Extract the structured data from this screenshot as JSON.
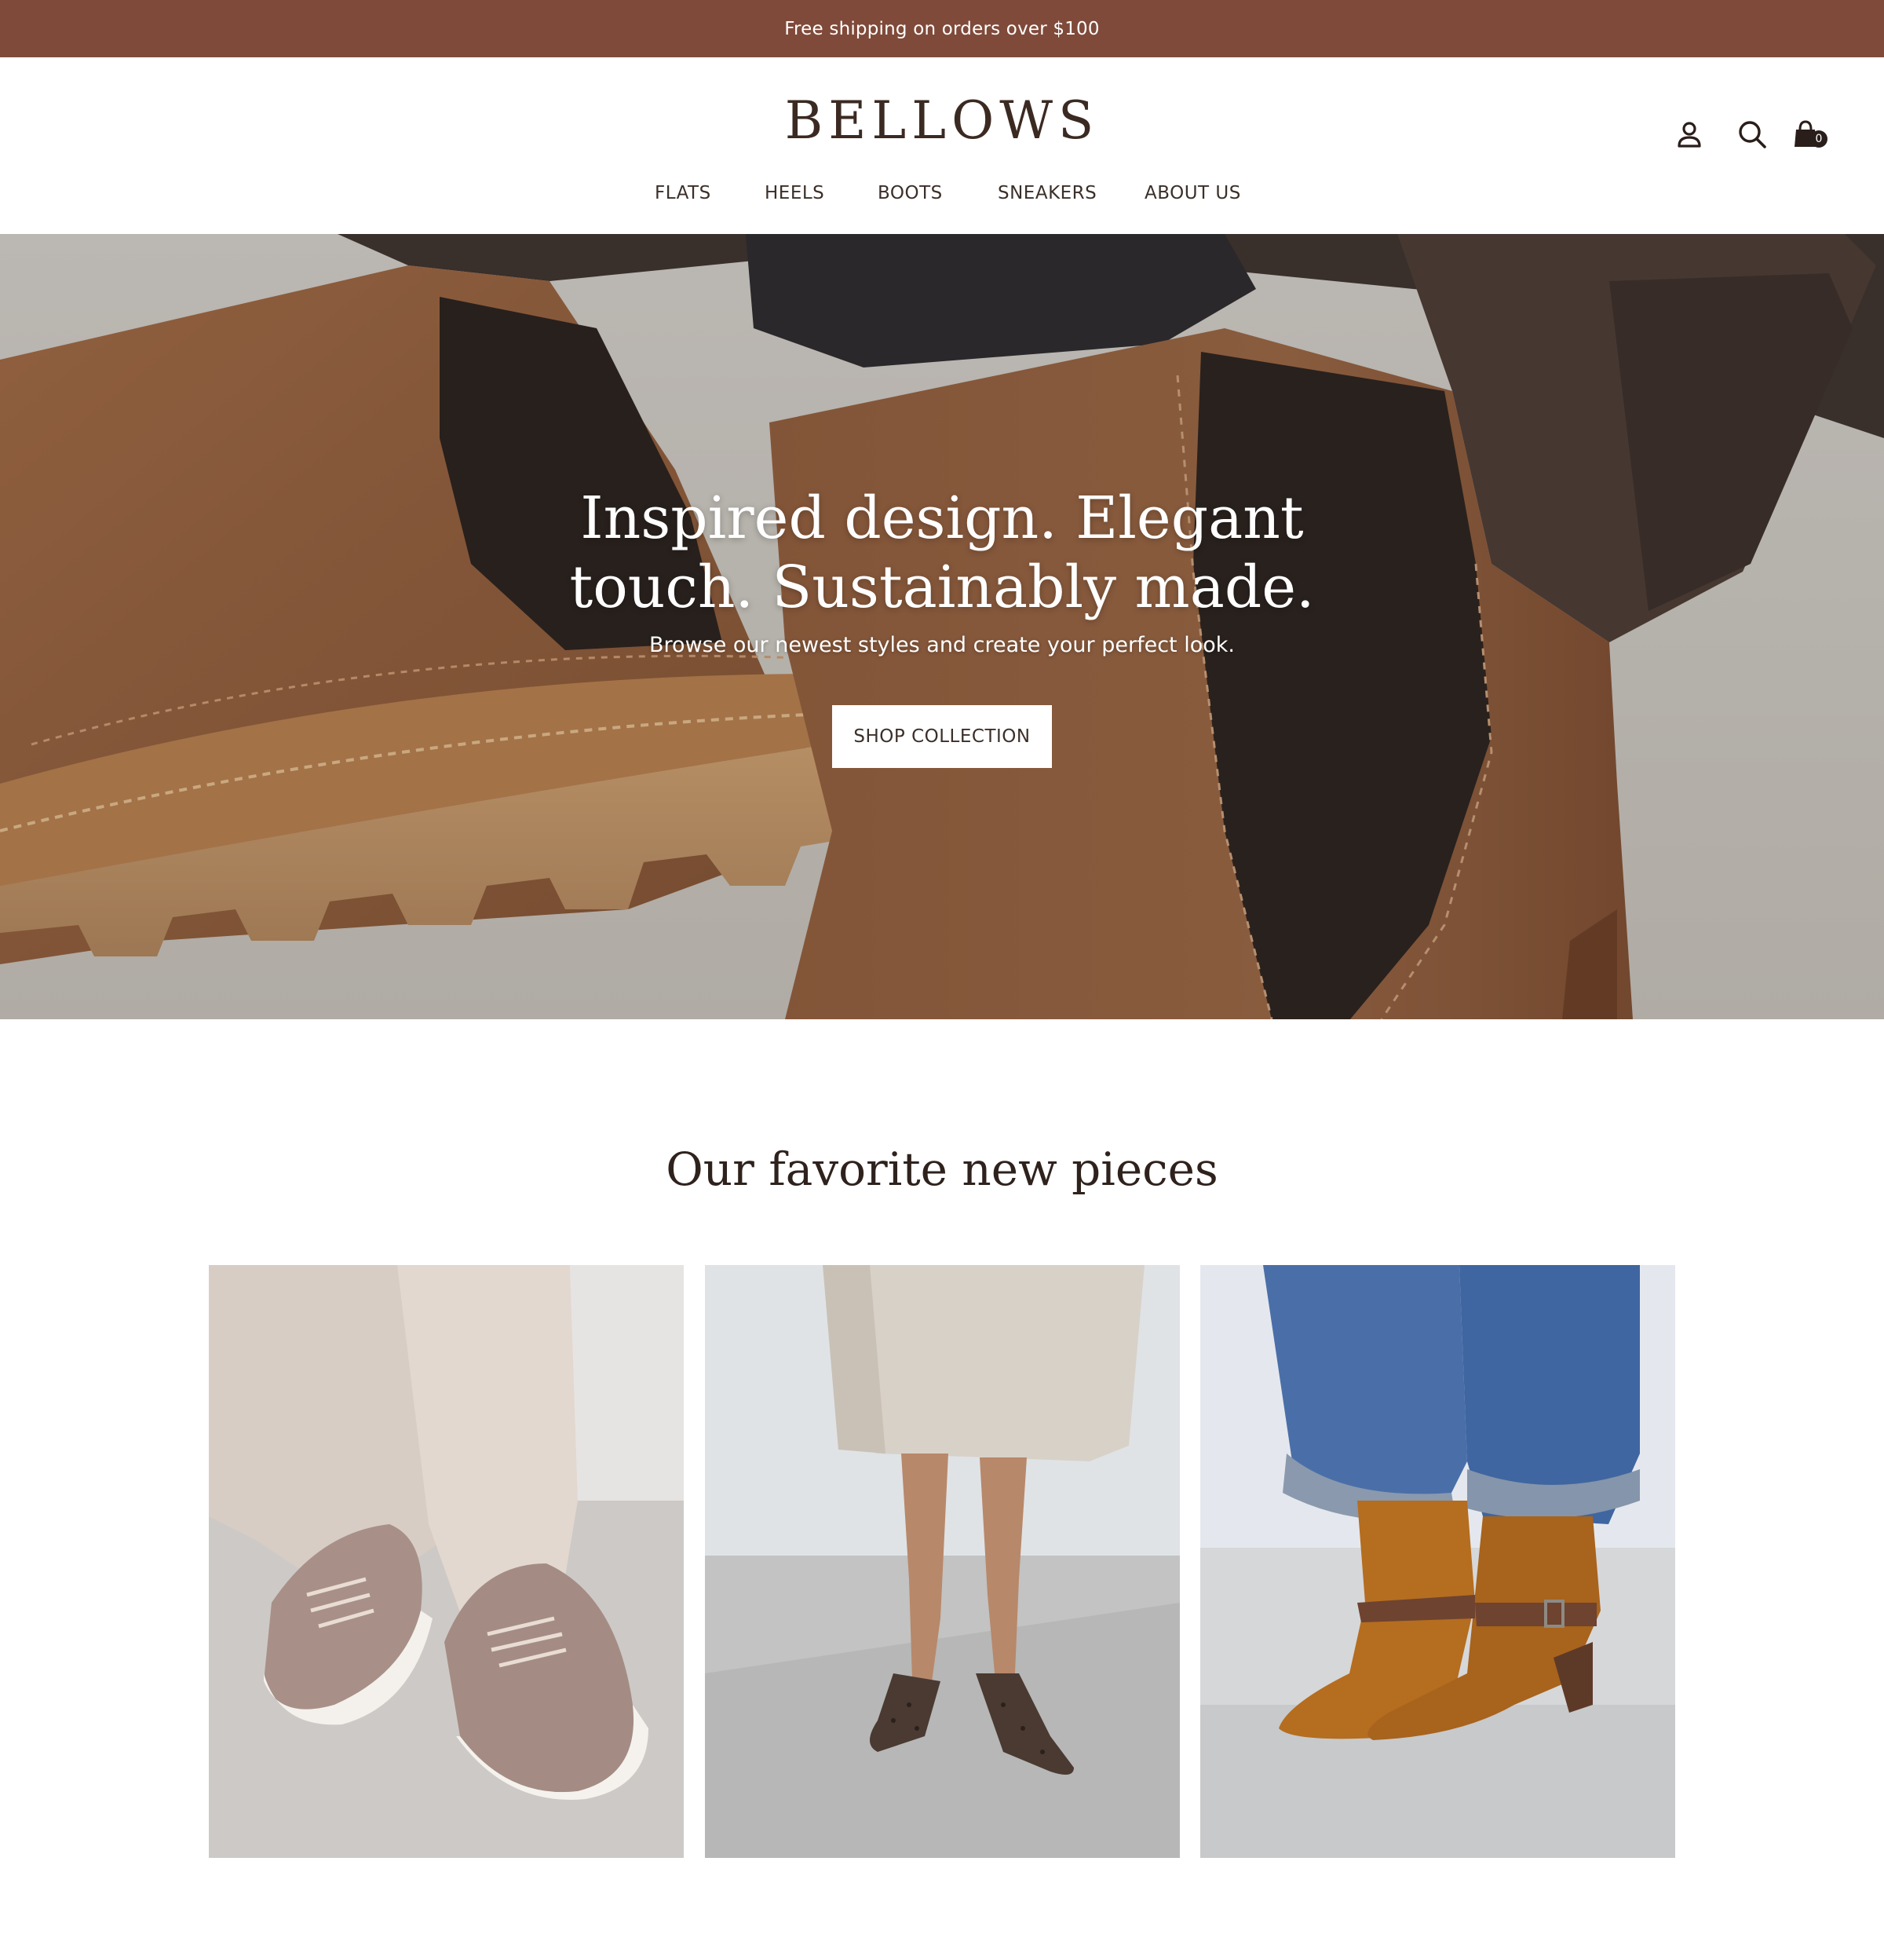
{
  "announcement": {
    "text": "Free shipping on orders over $100"
  },
  "header": {
    "logo": "BELLOWS",
    "nav": [
      {
        "label": "FLATS"
      },
      {
        "label": "HEELS"
      },
      {
        "label": "BOOTS"
      },
      {
        "label": "SNEAKERS"
      },
      {
        "label": "ABOUT US"
      }
    ],
    "icons": [
      "account-icon",
      "search-icon",
      "cart-icon"
    ],
    "cart_count": "0"
  },
  "hero": {
    "title_line1": "Inspired design. Elegant",
    "title_line2": "touch. Sustainably made.",
    "subtitle": "Browse our newest styles and create your perfect look.",
    "cta": "SHOP COLLECTION"
  },
  "featured": {
    "title": "Our favorite new pieces",
    "products": [
      {
        "image": "taupe-sneakers-image"
      },
      {
        "image": "leopard-heels-image"
      },
      {
        "image": "suede-ankle-boots-image"
      }
    ]
  },
  "colors": {
    "announcement_bg": "#7f4a3a",
    "text_dark": "#3b2a22",
    "suede_brown": "#8a5a3c"
  }
}
